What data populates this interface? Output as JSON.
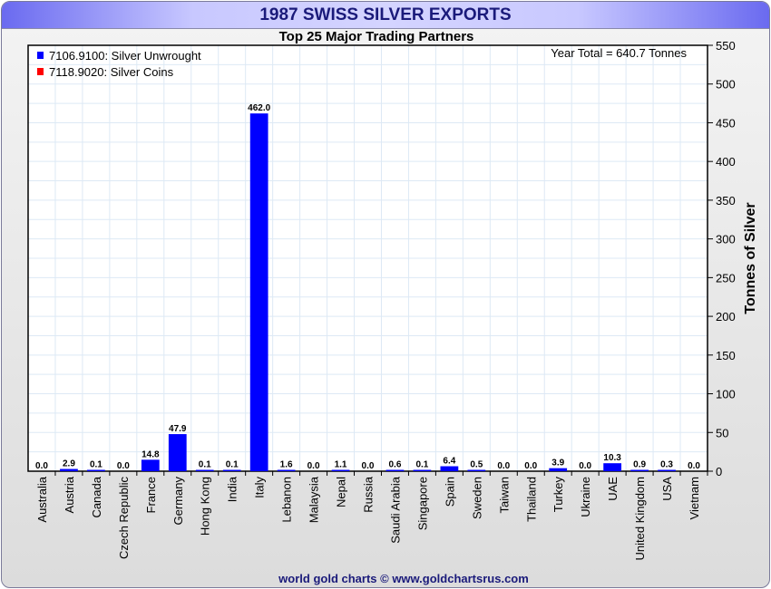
{
  "chart_data": {
    "type": "bar",
    "title": "1987 SWISS SILVER EXPORTS",
    "subtitle": "Top 25 Major Trading Partners",
    "annotation": "Year Total = 640.7 Tonnes",
    "footer": "world gold charts © www.goldchartsrus.com",
    "xlabel": "",
    "ylabel": "Tonnes of Silver",
    "ylim": [
      0,
      550
    ],
    "yticks": [
      0,
      50,
      100,
      150,
      200,
      250,
      300,
      350,
      400,
      450,
      500,
      550
    ],
    "grid": true,
    "legend_position": "top-left",
    "categories": [
      "Australia",
      "Austria",
      "Canada",
      "Czech Republic",
      "France",
      "Germany",
      "Hong Kong",
      "India",
      "Italy",
      "Lebanon",
      "Malaysia",
      "Nepal",
      "Russia",
      "Saudi Arabia",
      "Singapore",
      "Spain",
      "Sweden",
      "Taiwan",
      "Thailand",
      "Turkey",
      "Ukraine",
      "UAE",
      "United Kingdom",
      "USA",
      "Vietnam"
    ],
    "series": [
      {
        "name": "7106.9100: Silver Unwrought",
        "color": "#0000ff",
        "values": [
          0.0,
          2.9,
          0.1,
          0.0,
          14.8,
          47.9,
          0.1,
          0.1,
          462.0,
          1.6,
          0.0,
          1.1,
          0.0,
          0.6,
          0.1,
          6.4,
          0.5,
          0.0,
          0.0,
          3.9,
          0.0,
          10.3,
          0.9,
          0.3,
          0.0
        ]
      },
      {
        "name": "7118.9020: Silver Coins",
        "color": "#ff0000",
        "values": [
          0,
          0,
          0,
          0,
          0,
          0,
          0,
          0,
          0,
          0,
          0,
          0,
          0,
          0,
          0,
          0,
          0,
          0,
          0,
          0,
          0,
          0,
          0,
          0,
          0
        ]
      }
    ],
    "data_labels": [
      "0.0",
      "2.9",
      "0.1",
      "0.0",
      "14.8",
      "47.9",
      "0.1",
      "0.1",
      "462.0",
      "1.6",
      "0.0",
      "1.1",
      "0.0",
      "0.6",
      "0.1",
      "6.4",
      "0.5",
      "0.0",
      "0.0",
      "3.9",
      "0.0",
      "10.3",
      "0.9",
      "0.3",
      "0.0"
    ]
  }
}
